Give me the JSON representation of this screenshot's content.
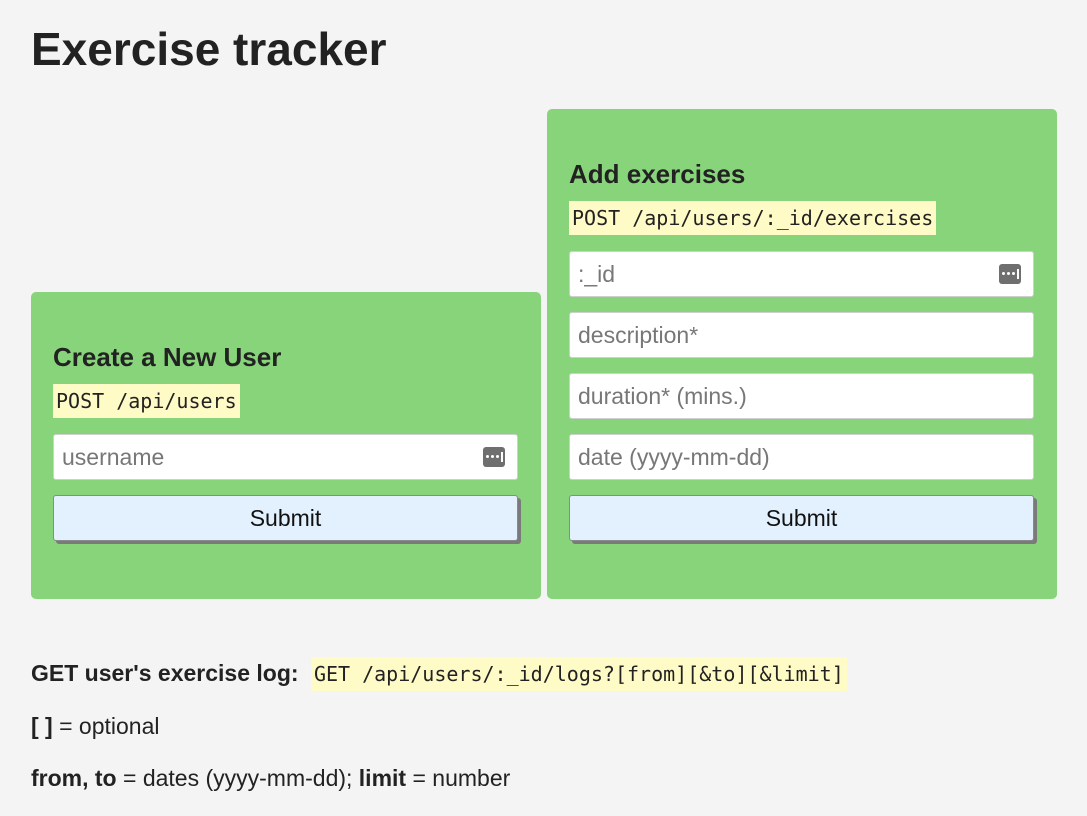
{
  "page": {
    "title": "Exercise tracker"
  },
  "create_user": {
    "heading": "Create a New User",
    "endpoint": "POST /api/users",
    "username_placeholder": "username",
    "submit_label": "Submit"
  },
  "add_exercises": {
    "heading": "Add exercises",
    "endpoint": "POST /api/users/:_id/exercises",
    "id_placeholder": ":_id",
    "description_placeholder": "description*",
    "duration_placeholder": "duration* (mins.)",
    "date_placeholder": "date (yyyy-mm-dd)",
    "submit_label": "Submit"
  },
  "log_info": {
    "label": "GET user's exercise log:",
    "endpoint": "GET /api/users/:_id/logs?[from][&to][&limit]",
    "optional_key": "[ ]",
    "optional_text": " = optional",
    "from_to_key": "from, to",
    "from_to_text": " = dates (yyyy-mm-dd); ",
    "limit_key": "limit",
    "limit_text": " = number"
  },
  "colors": {
    "card_bg": "#88d47b",
    "code_bg": "#fffbc6",
    "button_bg": "#e3f0fd",
    "page_bg": "#f4f4f4"
  },
  "icons": {
    "password_manager": "password-key-icon"
  }
}
